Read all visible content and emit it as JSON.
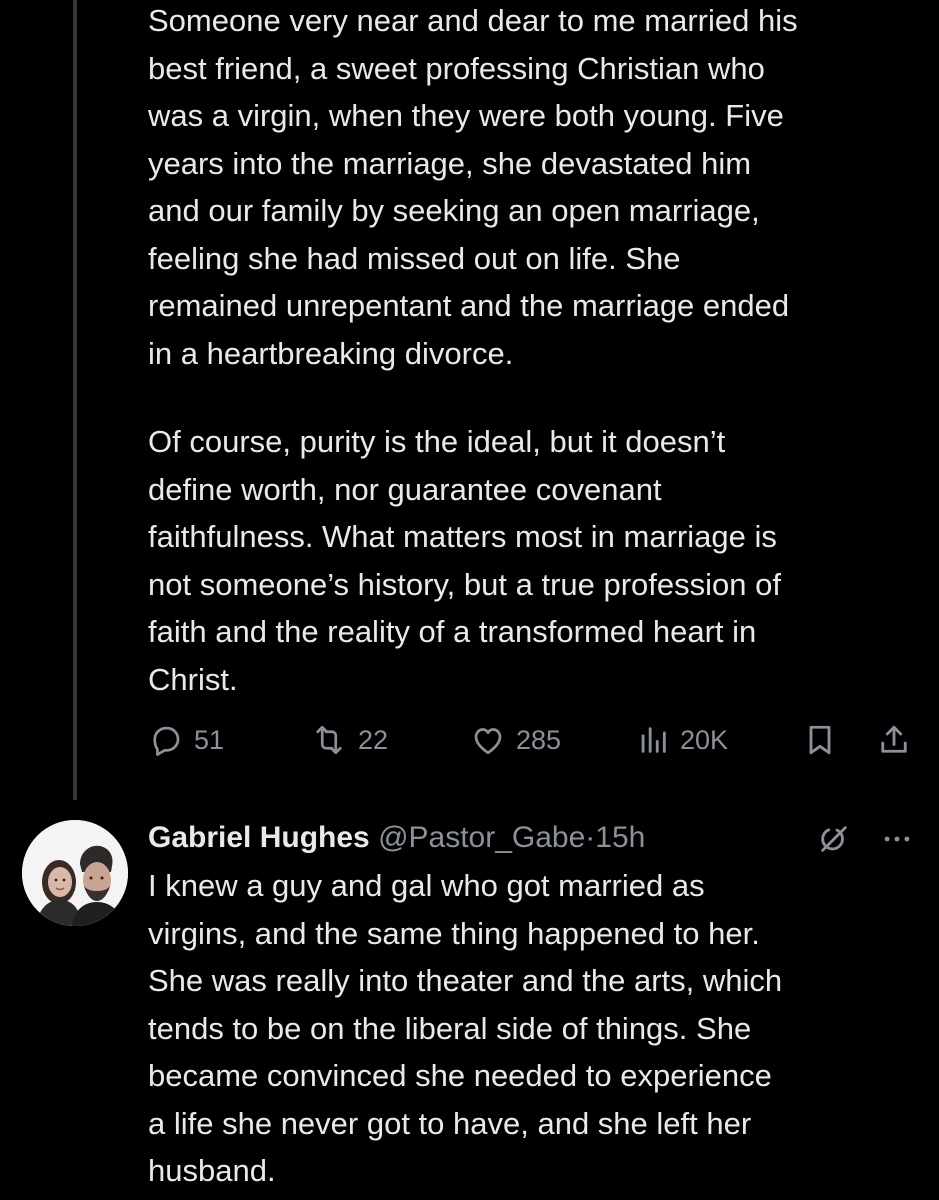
{
  "original_tweet": {
    "paragraph1": "Someone very near and dear to me married his\nbest friend, a sweet professing Christian who\nwas a virgin, when they were both young. Five\nyears into the marriage, she devastated him\nand our family by seeking an open marriage,\nfeeling she had missed out on life. She\nremained unrepentant and the marriage ended\nin a heartbreaking divorce.",
    "paragraph2": "Of course, purity is the ideal, but it doesn’t\ndefine worth, nor guarantee covenant\nfaithfulness. What matters most in marriage is\nnot someone’s history, but a true profession of\nfaith and the reality of a transformed heart in\nChrist.",
    "metrics": {
      "replies": "51",
      "reposts": "22",
      "likes": "285",
      "views": "20K"
    },
    "icons": [
      "reply-icon",
      "repost-icon",
      "like-icon",
      "views-icon",
      "bookmark-icon",
      "share-icon"
    ]
  },
  "reply_tweet": {
    "display_name": "Gabriel Hughes",
    "handle": "@Pastor_Gabe",
    "separator": "·",
    "time": "15h",
    "text": "I knew a guy and gal who got married as\nvirgins, and the same thing happened to her.\nShe was really into theater and the arts, which\ntends to be on the liberal side of things. She\nbecame convinced she needed to experience\na life she never got to have, and she left her\nhusband.",
    "icons": [
      "avatar",
      "grok-icon",
      "more-icon"
    ]
  },
  "colors": {
    "background": "#000000",
    "primary_text": "#e7e9ea",
    "secondary_text": "#8b9198",
    "thread_line": "#333639"
  }
}
